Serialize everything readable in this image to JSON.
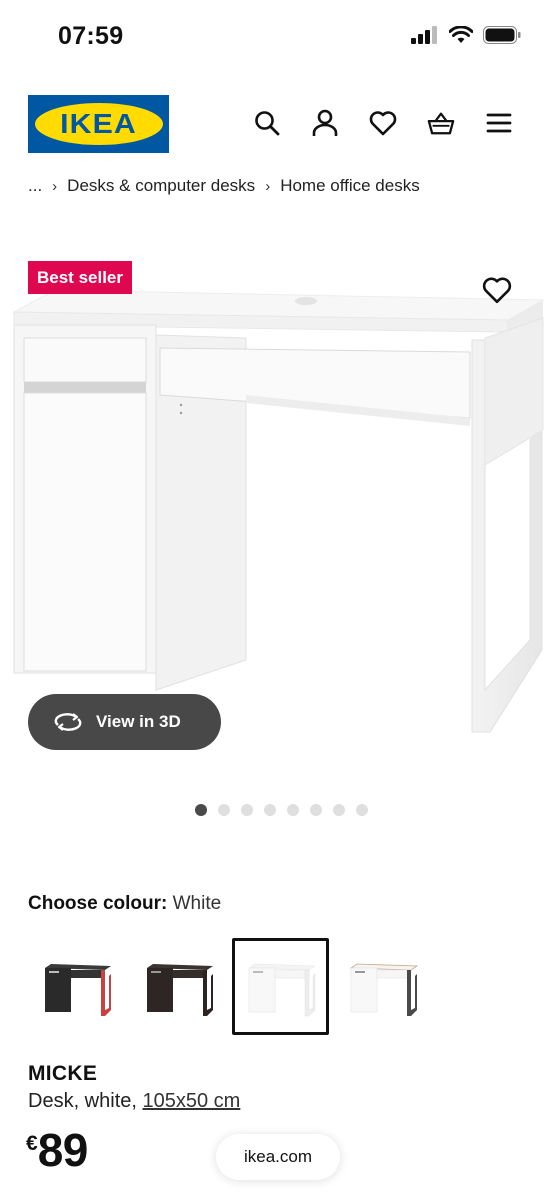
{
  "status_bar": {
    "time": "07:59"
  },
  "header": {
    "logo_text": "IKEA",
    "icons": [
      "search-icon",
      "profile-icon",
      "heart-icon",
      "basket-icon",
      "menu-icon"
    ]
  },
  "breadcrumb": {
    "items": [
      "...",
      "Desks & computer desks",
      "Home office desks"
    ]
  },
  "product_image": {
    "badge": "Best seller",
    "view_3d_label": "View in 3D",
    "carousel": {
      "total": 8,
      "active": 1
    }
  },
  "colour": {
    "label": "Choose colour:",
    "selected": "White",
    "options": [
      {
        "name": "black-brown/red",
        "selected": false
      },
      {
        "name": "black-brown",
        "selected": false
      },
      {
        "name": "white",
        "selected": true
      },
      {
        "name": "white/anthracite",
        "selected": false
      }
    ]
  },
  "product": {
    "name": "MICKE",
    "description": "Desk, white,",
    "dimensions": "105x50 cm",
    "currency": "€",
    "price": "89"
  },
  "browser": {
    "url": "ikea.com"
  },
  "colors": {
    "badge": "#e00751",
    "brand_blue": "#0058a3",
    "brand_yellow": "#ffdb00",
    "button_dark": "#484848"
  }
}
